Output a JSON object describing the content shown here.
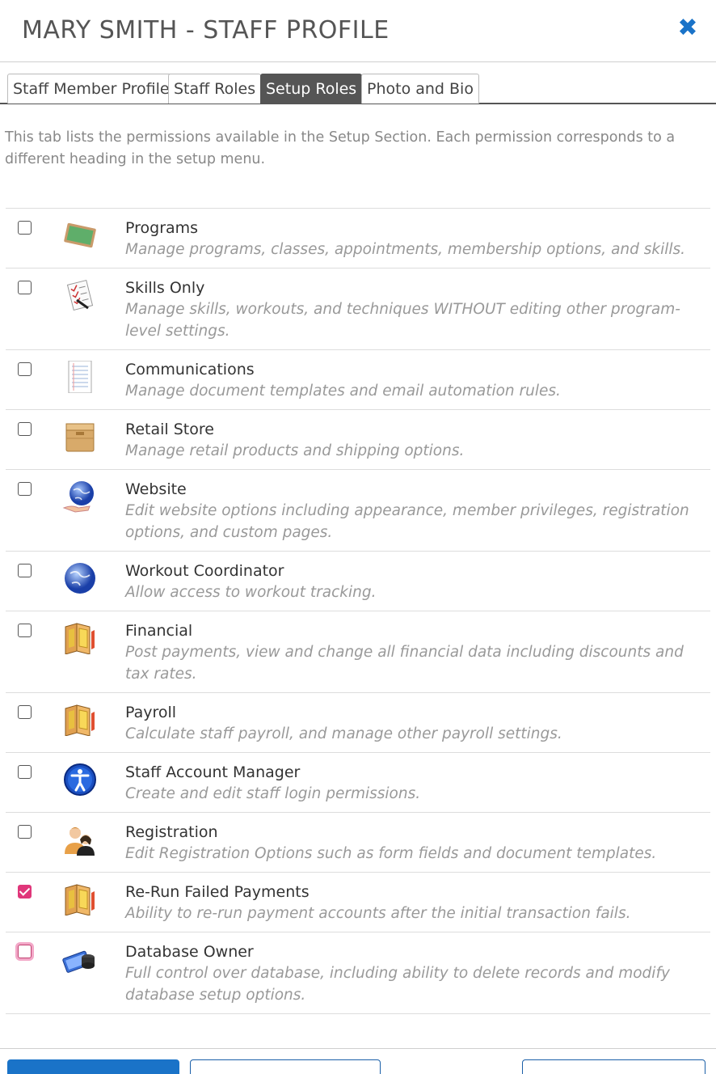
{
  "header": {
    "title": "MARY SMITH - STAFF PROFILE",
    "close_symbol": "✖",
    "accent_color": "#1a73c8"
  },
  "tabs": [
    {
      "label": "Staff Member Profile",
      "active": false
    },
    {
      "label": "Staff Roles",
      "active": false
    },
    {
      "label": "Setup Roles",
      "active": true
    },
    {
      "label": "Photo and Bio",
      "active": false
    }
  ],
  "intro": "This tab lists the permissions available in the Setup Section.  Each permission corresponds to a different heading in the setup menu.",
  "permissions": [
    {
      "name": "Programs",
      "description": "Manage programs, classes, appointments, membership options, and skills.",
      "icon": "chalkboard-icon",
      "checked": false
    },
    {
      "name": "Skills Only",
      "description": "Manage skills, workouts, and techniques WITHOUT editing other program-level settings.",
      "icon": "checklist-icon",
      "checked": false
    },
    {
      "name": "Communications",
      "description": "Manage document templates and email automation rules.",
      "icon": "document-icon",
      "checked": false
    },
    {
      "name": "Retail Store",
      "description": "Manage retail products and shipping options.",
      "icon": "box-icon",
      "checked": false
    },
    {
      "name": "Website",
      "description": "Edit website options including appearance, member privileges, registration options, and custom pages.",
      "icon": "globe-hand-icon",
      "checked": false
    },
    {
      "name": "Workout Coordinator",
      "description": "Allow access to workout tracking.",
      "icon": "globe-icon",
      "checked": false
    },
    {
      "name": "Financial",
      "description": "Post payments, view and change all financial data including discounts and tax rates.",
      "icon": "ledger-icon",
      "checked": false
    },
    {
      "name": "Payroll",
      "description": "Calculate staff payroll, and manage other payroll settings.",
      "icon": "ledger-icon",
      "checked": false
    },
    {
      "name": "Staff Account Manager",
      "description": "Create and edit staff login permissions.",
      "icon": "accessibility-icon",
      "checked": false
    },
    {
      "name": "Registration",
      "description": "Edit Registration Options such as form fields and document templates.",
      "icon": "users-icon",
      "checked": false
    },
    {
      "name": "Re-Run Failed Payments",
      "description": "Ability to re-run payment accounts after the initial transaction fails.",
      "icon": "ledger-icon",
      "checked": true
    },
    {
      "name": "Database Owner",
      "description": "Full control over database, including ability to delete records and modify database setup options.",
      "icon": "database-icon",
      "checked": false,
      "focused": true
    }
  ],
  "buttons": {
    "primary": "",
    "secondary": "",
    "tertiary": ""
  }
}
